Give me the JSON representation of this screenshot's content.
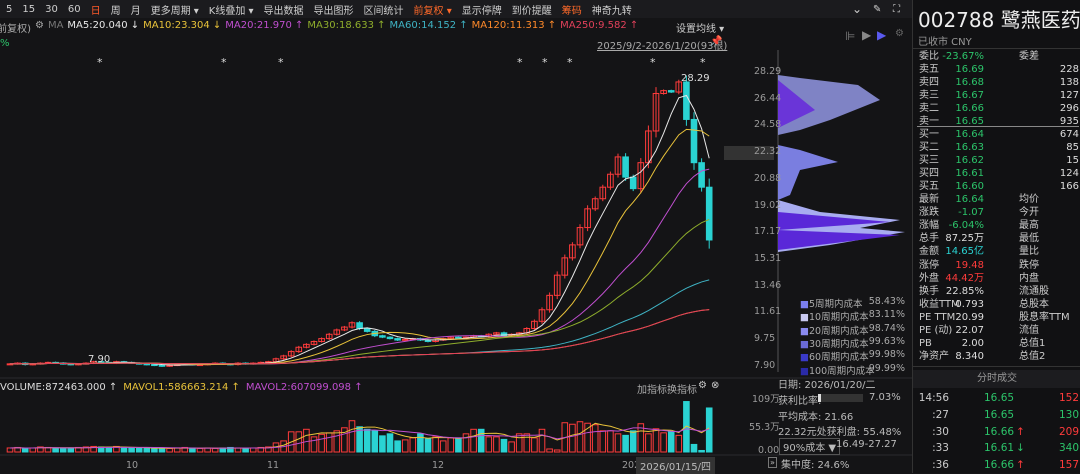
{
  "toolbar": {
    "items": [
      "5",
      "15",
      "30",
      "60",
      "日",
      "周",
      "月",
      "更多周期 ▾",
      "K线叠加 ▾",
      "导出数据",
      "导出图形",
      "区间统计",
      "前复权 ▾",
      "显示停牌",
      "到价提醒",
      "筹码",
      "神奇九转"
    ],
    "active": "日"
  },
  "ma_legend": {
    "prefix": "(日线 前复权)",
    "ma_label": "MA",
    "items": [
      {
        "text": "MA5:20.040 ↓",
        "color": "#e8e8e8"
      },
      {
        "text": "MA10:23.304 ↓",
        "color": "#e8c23a"
      },
      {
        "text": "MA20:21.970 ↑",
        "color": "#c04fd0"
      },
      {
        "text": "MA30:18.633 ↑",
        "color": "#8fae2c"
      },
      {
        "text": "MA60:14.152 ↑",
        "color": "#3fb3c4"
      },
      {
        "text": "MA120:11.313 ↑",
        "color": "#ff8a2a"
      },
      {
        "text": "MA250:9.582 ↑",
        "color": "#e0405a"
      }
    ]
  },
  "percent_label": "%",
  "set_ma_label": "设置均线 ▾",
  "date_range": "2025/9/2-2026/1/20(93根)",
  "price_axis": [
    "28.29",
    "26.44",
    "24.58",
    "22.32",
    "20.88",
    "19.02",
    "17.17",
    "15.31",
    "13.46",
    "11.61",
    "9.75",
    "7.90"
  ],
  "high_marker": "28.29",
  "low_marker": "7.90",
  "x_axis": [
    "10",
    "11",
    "12",
    "202"
  ],
  "crosshair_date": "2026/01/15/四",
  "volume": {
    "legend": [
      {
        "text": "VOLUME:872463.000 ↑",
        "color": "#dddddd"
      },
      {
        "text": "MAVOL1:586663.214 ↑",
        "color": "#e8c23a"
      },
      {
        "text": "MAVOL2:607099.098 ↑",
        "color": "#c04fd0"
      }
    ],
    "add_indicator": "加指标",
    "switch_indicator": "换指标",
    "axis": [
      "109万",
      "55.3万",
      "0.00"
    ]
  },
  "chart_data": {
    "type": "candlestick",
    "ylim": [
      7.9,
      28.29
    ],
    "close": [
      8.05,
      8.1,
      8.0,
      8.05,
      8.1,
      8.15,
      8.1,
      8.05,
      8.0,
      8.05,
      8.1,
      8.2,
      8.15,
      8.1,
      8.2,
      8.15,
      8.1,
      8.05,
      8.0,
      7.95,
      7.9,
      7.95,
      8.0,
      8.05,
      8.0,
      8.0,
      8.05,
      8.1,
      8.05,
      8.0,
      8.1,
      8.05,
      8.1,
      8.15,
      8.2,
      8.4,
      8.6,
      8.9,
      9.2,
      9.4,
      9.6,
      9.8,
      10.1,
      10.4,
      10.6,
      10.9,
      10.5,
      10.3,
      10.0,
      9.9,
      9.8,
      9.7,
      9.75,
      9.8,
      9.7,
      9.6,
      9.7,
      9.8,
      9.9,
      9.85,
      9.9,
      10.0,
      9.95,
      10.1,
      10.2,
      10.0,
      10.1,
      10.2,
      10.5,
      11.0,
      11.8,
      12.8,
      14.2,
      15.4,
      16.3,
      17.5,
      18.8,
      19.5,
      20.3,
      21.2,
      22.4,
      21.0,
      20.2,
      22.0,
      24.2,
      26.8,
      27.0,
      26.9,
      27.6,
      25.0,
      22.0,
      20.3,
      16.64
    ],
    "volume_wan": [
      8,
      9,
      7,
      8,
      10,
      9,
      8,
      7,
      8,
      9,
      10,
      11,
      10,
      9,
      11,
      9,
      8,
      7,
      8,
      7,
      8,
      7,
      8,
      9,
      8,
      7,
      8,
      7,
      8,
      9,
      8,
      7,
      8,
      9,
      10,
      18,
      22,
      40,
      40,
      45,
      30,
      35,
      38,
      42,
      48,
      62,
      50,
      45,
      42,
      32,
      36,
      22,
      24,
      28,
      36,
      26,
      30,
      22,
      28,
      28,
      36,
      45,
      45,
      30,
      30,
      25,
      20,
      36,
      36,
      28,
      45,
      6,
      4,
      58,
      55,
      60,
      57,
      54,
      42,
      42,
      36,
      33,
      42,
      56,
      36,
      46,
      38,
      40,
      33,
      100,
      15,
      3,
      87.25
    ],
    "volume_ylim": [
      0,
      109
    ]
  },
  "chips": {
    "items": [
      {
        "label": "5周期内成本",
        "value": "58.43%"
      },
      {
        "label": "10周期内成本",
        "value": "83.11%"
      },
      {
        "label": "20周期内成本",
        "value": "98.74%"
      },
      {
        "label": "30周期内成本",
        "value": "99.63%"
      },
      {
        "label": "60周期内成本",
        "value": "99.98%"
      },
      {
        "label": "100周期内成本",
        "value": "99.99%"
      }
    ],
    "date": "日期: 2026/01/20/二",
    "profit_ratio_label": "获利比率:",
    "profit_ratio": "7.03%",
    "profit_ratio_value": 0.0703,
    "avg_cost": "平均成本: 21.66",
    "at_price": "22.32元处获利盘: 55.48%",
    "cost_select": "90%成本",
    "cost_range": "16.49-27.27",
    "concentration": "集中度: 24.6%"
  },
  "quote": {
    "code": "002788",
    "name": "鹭燕医药",
    "status": "已收市 CNY",
    "weibi": {
      "label": "委比",
      "value": "-23.67%",
      "label2": "委差"
    },
    "asks": [
      {
        "l": "卖五",
        "p": "16.69",
        "q": "228"
      },
      {
        "l": "卖四",
        "p": "16.68",
        "q": "138"
      },
      {
        "l": "卖三",
        "p": "16.67",
        "q": "127"
      },
      {
        "l": "卖二",
        "p": "16.66",
        "q": "296"
      },
      {
        "l": "卖一",
        "p": "16.65",
        "q": "935"
      }
    ],
    "bids": [
      {
        "l": "买一",
        "p": "16.64",
        "q": "674"
      },
      {
        "l": "买二",
        "p": "16.63",
        "q": "85"
      },
      {
        "l": "买三",
        "p": "16.62",
        "q": "15"
      },
      {
        "l": "买四",
        "p": "16.61",
        "q": "124"
      },
      {
        "l": "买五",
        "p": "16.60",
        "q": "166"
      }
    ],
    "stats": [
      {
        "l": "最新",
        "v": "16.64",
        "c": "green",
        "l2": "均价"
      },
      {
        "l": "涨跌",
        "v": "-1.07",
        "c": "green",
        "l2": "今开"
      },
      {
        "l": "涨幅",
        "v": "-6.04%",
        "c": "green",
        "l2": "最高"
      },
      {
        "l": "总手",
        "v": "87.25万",
        "c": "white",
        "l2": "最低"
      },
      {
        "l": "金额",
        "v": "14.65亿",
        "c": "cyan",
        "l2": "量比"
      },
      {
        "l": "涨停",
        "v": "19.48",
        "c": "red",
        "l2": "跌停"
      },
      {
        "l": "外盘",
        "v": "44.42万",
        "c": "red",
        "l2": "内盘"
      },
      {
        "l": "换手",
        "v": "22.85%",
        "c": "white",
        "l2": "流通股"
      },
      {
        "l": "收益TTM",
        "v": "0.793",
        "c": "white",
        "l2": "总股本"
      },
      {
        "l": "PE TTM",
        "v": "20.99",
        "c": "white",
        "l2": "股息率TTM"
      },
      {
        "l": "PE (动)",
        "v": "22.07",
        "c": "white",
        "l2": "流值"
      },
      {
        "l": "PB",
        "v": "2.00",
        "c": "white",
        "l2": "总值1"
      },
      {
        "l": "净资产",
        "v": "8.340",
        "c": "white",
        "l2": "总值2"
      }
    ]
  },
  "ticks": {
    "title": "分时成交",
    "rows": [
      {
        "t": "14:56",
        "p": "16.65",
        "a": "",
        "q": "152",
        "qc": "red"
      },
      {
        "t": ":27",
        "p": "16.65",
        "a": "",
        "q": "130",
        "qc": "green"
      },
      {
        "t": ":30",
        "p": "16.66",
        "a": "↑",
        "q": "209",
        "qc": "red"
      },
      {
        "t": ":33",
        "p": "16.61",
        "a": "↓",
        "q": "340",
        "qc": "green"
      },
      {
        "t": ":36",
        "p": "16.66",
        "a": "↑",
        "q": "157",
        "qc": "red"
      }
    ]
  }
}
